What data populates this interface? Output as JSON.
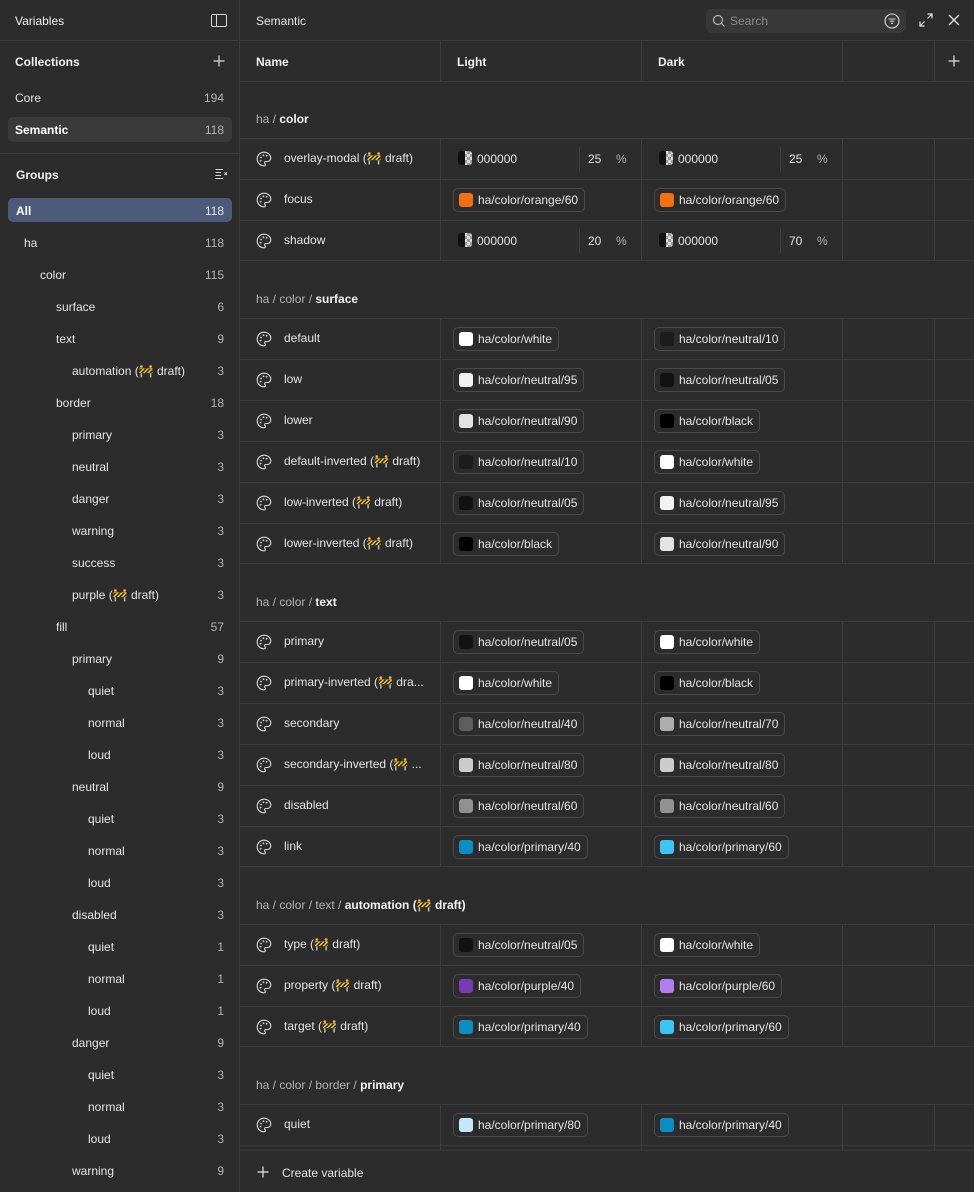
{
  "sidebar": {
    "title": "Variables",
    "collections_title": "Collections",
    "collections": [
      {
        "label": "Core",
        "count": "194"
      },
      {
        "label": "Semantic",
        "count": "118"
      }
    ],
    "groups_title": "Groups",
    "groups": [
      {
        "label": "All",
        "count": "118"
      },
      {
        "label": "ha",
        "count": "118"
      },
      {
        "label": "color",
        "count": "115"
      },
      {
        "label": "surface",
        "count": "6"
      },
      {
        "label": "text",
        "count": "9"
      },
      {
        "label": "automation (🚧 draft)",
        "count": "3"
      },
      {
        "label": "border",
        "count": "18"
      },
      {
        "label": "primary",
        "count": "3"
      },
      {
        "label": "neutral",
        "count": "3"
      },
      {
        "label": "danger",
        "count": "3"
      },
      {
        "label": "warning",
        "count": "3"
      },
      {
        "label": "success",
        "count": "3"
      },
      {
        "label": "purple (🚧 draft)",
        "count": "3"
      },
      {
        "label": "fill",
        "count": "57"
      },
      {
        "label": "primary",
        "count": "9"
      },
      {
        "label": "quiet",
        "count": "3"
      },
      {
        "label": "normal",
        "count": "3"
      },
      {
        "label": "loud",
        "count": "3"
      },
      {
        "label": "neutral",
        "count": "9"
      },
      {
        "label": "quiet",
        "count": "3"
      },
      {
        "label": "normal",
        "count": "3"
      },
      {
        "label": "loud",
        "count": "3"
      },
      {
        "label": "disabled",
        "count": "3"
      },
      {
        "label": "quiet",
        "count": "1"
      },
      {
        "label": "normal",
        "count": "1"
      },
      {
        "label": "loud",
        "count": "1"
      },
      {
        "label": "danger",
        "count": "9"
      },
      {
        "label": "quiet",
        "count": "3"
      },
      {
        "label": "normal",
        "count": "3"
      },
      {
        "label": "loud",
        "count": "3"
      },
      {
        "label": "warning",
        "count": "9"
      }
    ]
  },
  "topbar": {
    "title": "Semantic",
    "search_placeholder": "Search"
  },
  "columns": {
    "name": "Name",
    "light": "Light",
    "dark": "Dark"
  },
  "sections": [
    {
      "path": "ha / ",
      "bold": "color",
      "rows": [
        {
          "name": "overlay-modal (🚧 draft)",
          "light": {
            "hex": "000000",
            "opacity": "25",
            "pct": "%"
          },
          "dark": {
            "hex": "000000",
            "opacity": "25",
            "pct": "%"
          }
        },
        {
          "name": "focus",
          "light": {
            "ref": "ha/color/orange/60",
            "color": "#f2700f"
          },
          "dark": {
            "ref": "ha/color/orange/60",
            "color": "#f2700f"
          }
        },
        {
          "name": "shadow",
          "light": {
            "hex": "000000",
            "opacity": "20",
            "pct": "%"
          },
          "dark": {
            "hex": "000000",
            "opacity": "70",
            "pct": "%"
          }
        }
      ]
    },
    {
      "path": "ha / color / ",
      "bold": "surface",
      "rows": [
        {
          "name": "default",
          "light": {
            "ref": "ha/color/white",
            "color": "#ffffff"
          },
          "dark": {
            "ref": "ha/color/neutral/10",
            "color": "#1c1c1c"
          }
        },
        {
          "name": "low",
          "light": {
            "ref": "ha/color/neutral/95",
            "color": "#f2f2f2"
          },
          "dark": {
            "ref": "ha/color/neutral/05",
            "color": "#121212"
          }
        },
        {
          "name": "lower",
          "light": {
            "ref": "ha/color/neutral/90",
            "color": "#e3e3e3"
          },
          "dark": {
            "ref": "ha/color/black",
            "color": "#000000"
          }
        },
        {
          "name": "default-inverted (🚧 draft)",
          "light": {
            "ref": "ha/color/neutral/10",
            "color": "#1c1c1c"
          },
          "dark": {
            "ref": "ha/color/white",
            "color": "#ffffff"
          }
        },
        {
          "name": "low-inverted (🚧 draft)",
          "light": {
            "ref": "ha/color/neutral/05",
            "color": "#121212"
          },
          "dark": {
            "ref": "ha/color/neutral/95",
            "color": "#f2f2f2"
          }
        },
        {
          "name": "lower-inverted (🚧 draft)",
          "light": {
            "ref": "ha/color/black",
            "color": "#000000"
          },
          "dark": {
            "ref": "ha/color/neutral/90",
            "color": "#e3e3e3"
          }
        }
      ]
    },
    {
      "path": "ha / color / ",
      "bold": "text",
      "rows": [
        {
          "name": "primary",
          "light": {
            "ref": "ha/color/neutral/05",
            "color": "#121212"
          },
          "dark": {
            "ref": "ha/color/white",
            "color": "#ffffff"
          }
        },
        {
          "name": "primary-inverted (🚧 dra...",
          "light": {
            "ref": "ha/color/white",
            "color": "#ffffff"
          },
          "dark": {
            "ref": "ha/color/black",
            "color": "#000000"
          }
        },
        {
          "name": "secondary",
          "light": {
            "ref": "ha/color/neutral/40",
            "color": "#5e5e5e"
          },
          "dark": {
            "ref": "ha/color/neutral/70",
            "color": "#adadad"
          }
        },
        {
          "name": "secondary-inverted (🚧 ...",
          "light": {
            "ref": "ha/color/neutral/80",
            "color": "#cccccc"
          },
          "dark": {
            "ref": "ha/color/neutral/80",
            "color": "#cccccc"
          }
        },
        {
          "name": "disabled",
          "light": {
            "ref": "ha/color/neutral/60",
            "color": "#919191"
          },
          "dark": {
            "ref": "ha/color/neutral/60",
            "color": "#919191"
          }
        },
        {
          "name": "link",
          "light": {
            "ref": "ha/color/primary/40",
            "color": "#0a8fc2"
          },
          "dark": {
            "ref": "ha/color/primary/60",
            "color": "#3cc4f5"
          }
        }
      ]
    },
    {
      "path": "ha / color / text / ",
      "bold": "automation (🚧 draft)",
      "rows": [
        {
          "name": "type (🚧 draft)",
          "light": {
            "ref": "ha/color/neutral/05",
            "color": "#121212"
          },
          "dark": {
            "ref": "ha/color/white",
            "color": "#ffffff"
          }
        },
        {
          "name": "property (🚧 draft)",
          "light": {
            "ref": "ha/color/purple/40",
            "color": "#7a3ab8"
          },
          "dark": {
            "ref": "ha/color/purple/60",
            "color": "#b57ef0"
          }
        },
        {
          "name": "target (🚧 draft)",
          "light": {
            "ref": "ha/color/primary/40",
            "color": "#0a8fc2"
          },
          "dark": {
            "ref": "ha/color/primary/60",
            "color": "#3cc4f5"
          }
        }
      ]
    },
    {
      "path": "ha / color / border / ",
      "bold": "primary",
      "rows": [
        {
          "name": "quiet",
          "light": {
            "ref": "ha/color/primary/80",
            "color": "#c2e8fa"
          },
          "dark": {
            "ref": "ha/color/primary/40",
            "color": "#0a8fc2"
          }
        },
        {
          "name": "",
          "light": {},
          "dark": {}
        }
      ]
    }
  ],
  "footer": {
    "create_label": "Create variable"
  }
}
